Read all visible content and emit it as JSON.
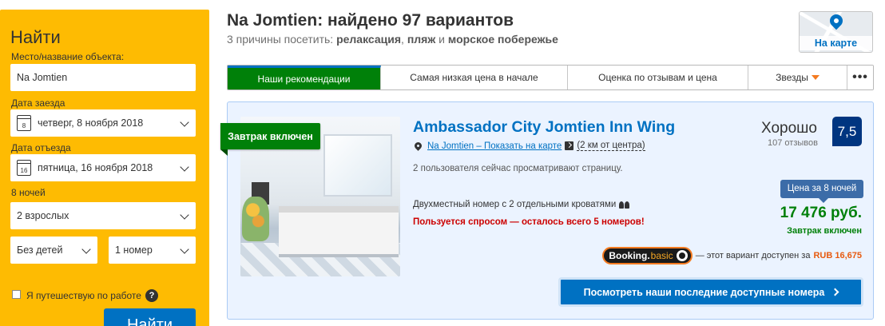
{
  "sidebar": {
    "title": "Найти",
    "destination_label": "Место/название объекта:",
    "destination_value": "Na Jomtien",
    "checkin_label": "Дата заезда",
    "checkin_day": "8",
    "checkin_value": "четверг, 8 ноября 2018",
    "checkout_label": "Дата отъезда",
    "checkout_day": "16",
    "checkout_value": "пятница, 16 ноября 2018",
    "nights": "8 ночей",
    "adults": "2 взрослых",
    "children": "Без детей",
    "rooms": "1 номер",
    "business_label": "Я путешествую по работе",
    "help_glyph": "?",
    "search_button": "Найти"
  },
  "header": {
    "title": "Na Jomtien: найдено 97 вариантов",
    "reasons_prefix": "3 причины посетить: ",
    "reason1": "релаксация",
    "sep1": ", ",
    "reason2": "пляж",
    "sep2": " и ",
    "reason3": "морское побережье",
    "map_button": "На карте"
  },
  "sort_tabs": [
    {
      "label": "Наши рекомендации",
      "active": true
    },
    {
      "label": "Самая низкая цена в начале",
      "active": false
    },
    {
      "label": "Оценка по отзывам и цена",
      "active": false
    },
    {
      "label": "Звезды",
      "active": false
    },
    {
      "label": "•••",
      "active": false
    }
  ],
  "property": {
    "ribbon": "Завтрак включен",
    "name": "Ambassador City Jomtien Inn Wing",
    "location_link": "Na Jomtien – Показать на карте",
    "distance": "(2 км от центра)",
    "viewing": "2 пользователя сейчас просматривают страницу.",
    "room": "Двухместный номер с 2 отдельными кроватями",
    "demand": "Пользуется спросом — осталось всего 5 номеров!",
    "rating_word": "Хорошо",
    "review_count": "107 отзывов",
    "score": "7,5",
    "price_tag": "Цена за 8 ночей",
    "price": "17 476 руб.",
    "breakfast_note": "Завтрак включен",
    "bb_brand": "Booking.",
    "bb_suffix": "basic",
    "bb_text": "— этот вариант доступен за",
    "bb_price": "RUB 16,675",
    "cta": "Посмотреть наши последние доступные номера"
  },
  "colors": {
    "search_panel": "#febb02",
    "brand_blue": "#0071c2",
    "active_tab": "#008009",
    "score_bg": "#003580",
    "demand_red": "#cc0000"
  }
}
